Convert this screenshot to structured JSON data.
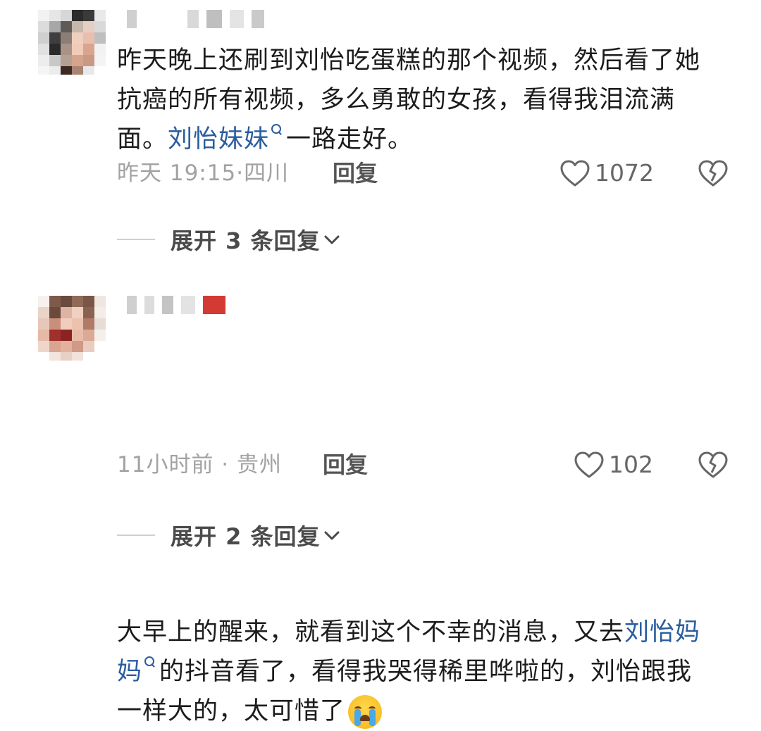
{
  "comments": [
    {
      "text_before": "昨天晚上还刷到刘怡吃蛋糕的那个视频，然后看了她抗癌的所有视频，多么勇敢的女孩，看得我泪流满面。",
      "mention": "刘怡妹妹",
      "text_after": "一路走好。",
      "emoji": "",
      "time": "昨天 19:15",
      "location": "四川",
      "reply_label": "回复",
      "likes": "1072",
      "expand_label": "展开 3 条回复"
    },
    {
      "text_before": "大早上的醒来，就看到这个不幸的消息，又去",
      "mention": "刘怡妈妈",
      "text_after": "的抖音看了，看得我哭得稀里哗啦的，刘怡跟我一样大的，太可惜了",
      "emoji": "loudly-crying-face",
      "time": "11小时前",
      "location": "贵州",
      "reply_label": "回复",
      "likes": "102",
      "expand_label": "展开 2 条回复"
    }
  ],
  "colors": {
    "mention": "#2a5d9f",
    "meta": "#a2a2a2",
    "text": "#1c1c1c"
  },
  "icons": [
    "search-icon",
    "heart-outline-icon",
    "broken-heart-icon",
    "chevron-down-icon",
    "loudly-crying-face-emoji"
  ]
}
